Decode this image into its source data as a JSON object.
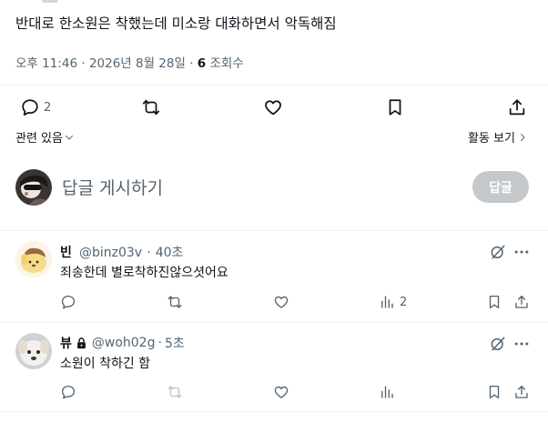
{
  "tweet": {
    "text": "반대로 한소원은 착했는데 미소랑 대화하면서 악독해짐",
    "time": "오후 11:46",
    "date": "2026년 8월 28일",
    "views_count": "6",
    "views_label": "조회수",
    "sep": "·"
  },
  "actions": {
    "reply_count": "2",
    "retweet_count": "",
    "like_count": ""
  },
  "related": {
    "label": "관련 있음",
    "view_activity": "활동 보기"
  },
  "compose": {
    "placeholder": "답글 게시하기",
    "button": "답글"
  },
  "replies": [
    {
      "name": "빈",
      "handle": "@binz03v",
      "time": "40초",
      "text": "죄송한데 별로착하진않으셧어요",
      "reply_count": "",
      "retweet_count": "",
      "like_count": "",
      "views_count": "2"
    },
    {
      "name": "뷰",
      "handle": "@woh02g",
      "time": "5초",
      "text": "소원이 착하긴 함",
      "reply_count": "",
      "retweet_count": "",
      "like_count": "",
      "views_count": ""
    }
  ],
  "colors": {
    "text": "#0f1419",
    "muted": "#536471",
    "divider": "#eff3f4",
    "button_disabled": "#c4c8cb"
  }
}
